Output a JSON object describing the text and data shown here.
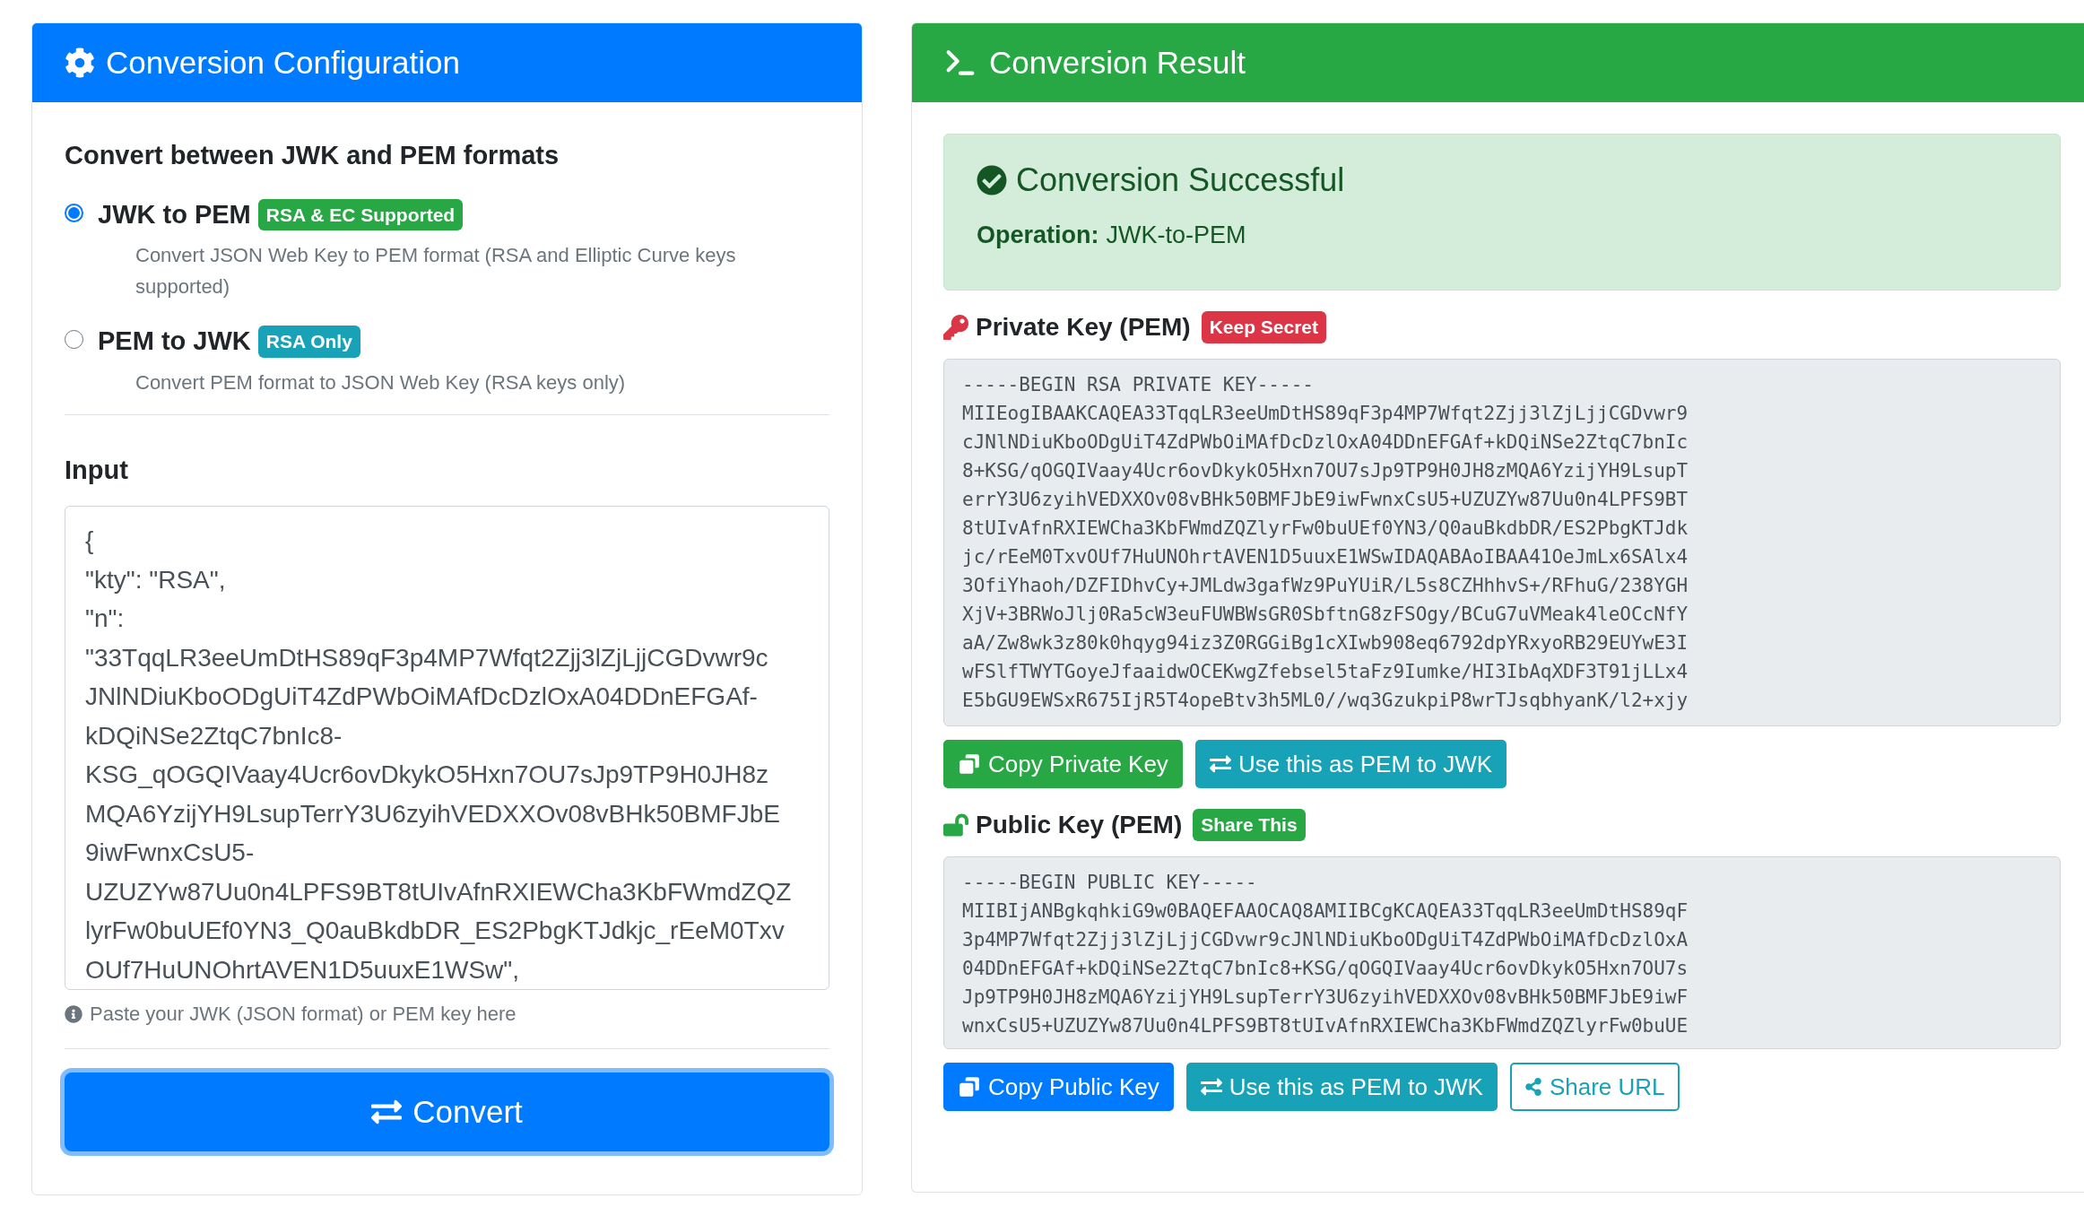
{
  "config": {
    "title": "Conversion Configuration",
    "heading": "Convert between JWK and PEM formats",
    "options": [
      {
        "label": "JWK to PEM",
        "badge": {
          "text": "RSA & EC Supported",
          "color": "#28a745"
        },
        "description": "Convert JSON Web Key to PEM format (RSA and Elliptic Curve keys supported)",
        "selected": true
      },
      {
        "label": "PEM to JWK",
        "badge": {
          "text": "RSA Only",
          "color": "#17a2b8"
        },
        "description": "Convert PEM format to JSON Web Key (RSA keys only)",
        "selected": false
      }
    ],
    "input": {
      "label": "Input",
      "lines": [
        "{",
        "\"kty\": \"RSA\",",
        "\"n\":",
        "\"33TqqLR3eeUmDtHS89qF3p4MP7Wfqt2Zjj3lZjLjjCGDvwr9c",
        "JNlNDiuKboODgUiT4ZdPWbOiMAfDcDzlOxA04DDnEFGAf-",
        "kDQiNSe2ZtqC7bnIc8-",
        "KSG_qOGQIVaay4Ucr6ovDkykO5Hxn7OU7sJp9TP9H0JH8z",
        "MQA6YzijYH9LsupTerrY3U6zyihVEDXXOv08vBHk50BMFJbE",
        "9iwFwnxCsU5-",
        "UZUZYw87Uu0n4LPFS9BT8tUIvAfnRXIEWCha3KbFWmdZQZ",
        "lyrFw0buUEf0YN3_Q0auBkdbDR_ES2PbgKTJdkjc_rEeM0Txv",
        "OUf7HuUNOhrtAVEN1D5uuxE1WSw\","
      ],
      "hint": "Paste your JWK (JSON format) or PEM key here"
    },
    "button": "Convert"
  },
  "result": {
    "title": "Conversion Result",
    "alert": {
      "title": "Conversion Successful",
      "operation_label": "Operation:",
      "operation": "JWK-to-PEM"
    },
    "keys": [
      {
        "kind": "private",
        "title": "Private Key (PEM)",
        "badge": {
          "text": "Keep Secret",
          "color": "#dc3545"
        },
        "lines": [
          "-----BEGIN RSA PRIVATE KEY-----",
          "MIIEogIBAAKCAQEA33TqqLR3eeUmDtHS89qF3p4MP7Wfqt2Zjj3lZjLjjCGDvwr9",
          "cJNlNDiuKboODgUiT4ZdPWbOiMAfDcDzlOxA04DDnEFGAf+kDQiNSe2ZtqC7bnIc",
          "8+KSG/qOGQIVaay4Ucr6ovDkykO5Hxn7OU7sJp9TP9H0JH8zMQA6YzijYH9LsupT",
          "errY3U6zyihVEDXXOv08vBHk50BMFJbE9iwFwnxCsU5+UZUZYw87Uu0n4LPFS9BT",
          "8tUIvAfnRXIEWCha3KbFWmdZQZlyrFw0buUEf0YN3/Q0auBkdbDR/ES2PbgKTJdk",
          "jc/rEeM0TxvOUf7HuUNOhrtAVEN1D5uuxE1WSwIDAQABAoIBAA41OeJmLx6SAlx4",
          "3OfiYhaoh/DZFIDhvCy+JMLdw3gafWz9PuYUiR/L5s8CZHhhvS+/RFhuG/238YGH",
          "XjV+3BRWoJlj0Ra5cW3euFUWBWsGR0SbftnG8zFSOgy/BCuG7uVMeak4leOCcNfY",
          "aA/Zw8wk3z80k0hqyg94iz3Z0RGGiBg1cXIwb908eq6792dpYRxyoRB29EUYwE3I",
          "wFSlfTWYTGoyeJfaaidwOCEKwgZfebsel5taFz9Iumke/HI3IbAqXDF3T91jLLx4",
          "E5bGU9EWSxR675IjR5T4opeBtv3h5ML0//wq3GzukpiP8wrTJsqbhyanK/l2+xjy"
        ],
        "buttons": [
          {
            "label": "Copy Private Key",
            "kind": "copy"
          },
          {
            "label": "Use this as PEM to JWK",
            "kind": "use"
          }
        ]
      },
      {
        "kind": "public",
        "title": "Public Key (PEM)",
        "badge": {
          "text": "Share This",
          "color": "#28a745"
        },
        "lines": [
          "-----BEGIN PUBLIC KEY-----",
          "MIIBIjANBgkqhkiG9w0BAQEFAAOCAQ8AMIIBCgKCAQEA33TqqLR3eeUmDtHS89qF",
          "3p4MP7Wfqt2Zjj3lZjLjjCGDvwr9cJNlNDiuKboODgUiT4ZdPWbOiMAfDcDzlOxA",
          "04DDnEFGAf+kDQiNSe2ZtqC7bnIc8+KSG/qOGQIVaay4Ucr6ovDkykO5Hxn7OU7s",
          "Jp9TP9H0JH8zMQA6YzijYH9LsupTerrY3U6zyihVEDXXOv08vBHk50BMFJbE9iwF",
          "wnxCsU5+UZUZYw87Uu0n4LPFS9BT8tUIvAfnRXIEWCha3KbFWmdZQZlyrFw0buUE"
        ],
        "buttons": [
          {
            "label": "Copy Public Key",
            "kind": "copy"
          },
          {
            "label": "Use this as PEM to JWK",
            "kind": "use"
          },
          {
            "label": "Share URL",
            "kind": "share"
          }
        ]
      }
    ]
  }
}
